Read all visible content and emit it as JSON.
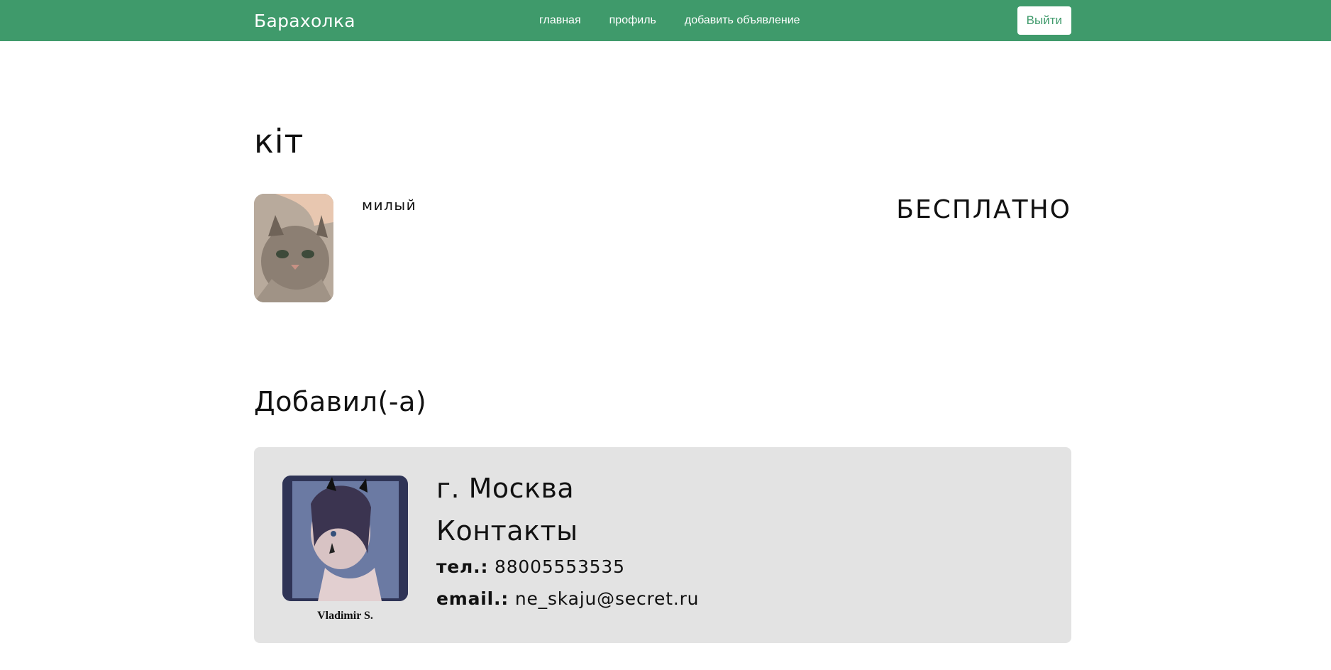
{
  "navbar": {
    "brand": "Барахолка",
    "links": [
      "главная",
      "профиль",
      "добавить объявление"
    ],
    "logout_label": "Выйти",
    "accent_color": "#3f9a6b"
  },
  "item": {
    "title": "кіт",
    "description": "милый",
    "price": "БЕСПЛАТНО"
  },
  "seller_section": {
    "title": "Добавил(-а)",
    "name": "Vladimir S.",
    "city": "г. Москва",
    "contacts_title": "Контакты",
    "phone_label": "тел.:",
    "phone": "88005553535",
    "email_label": "email.:",
    "email": "ne_skaju@secret.ru"
  }
}
